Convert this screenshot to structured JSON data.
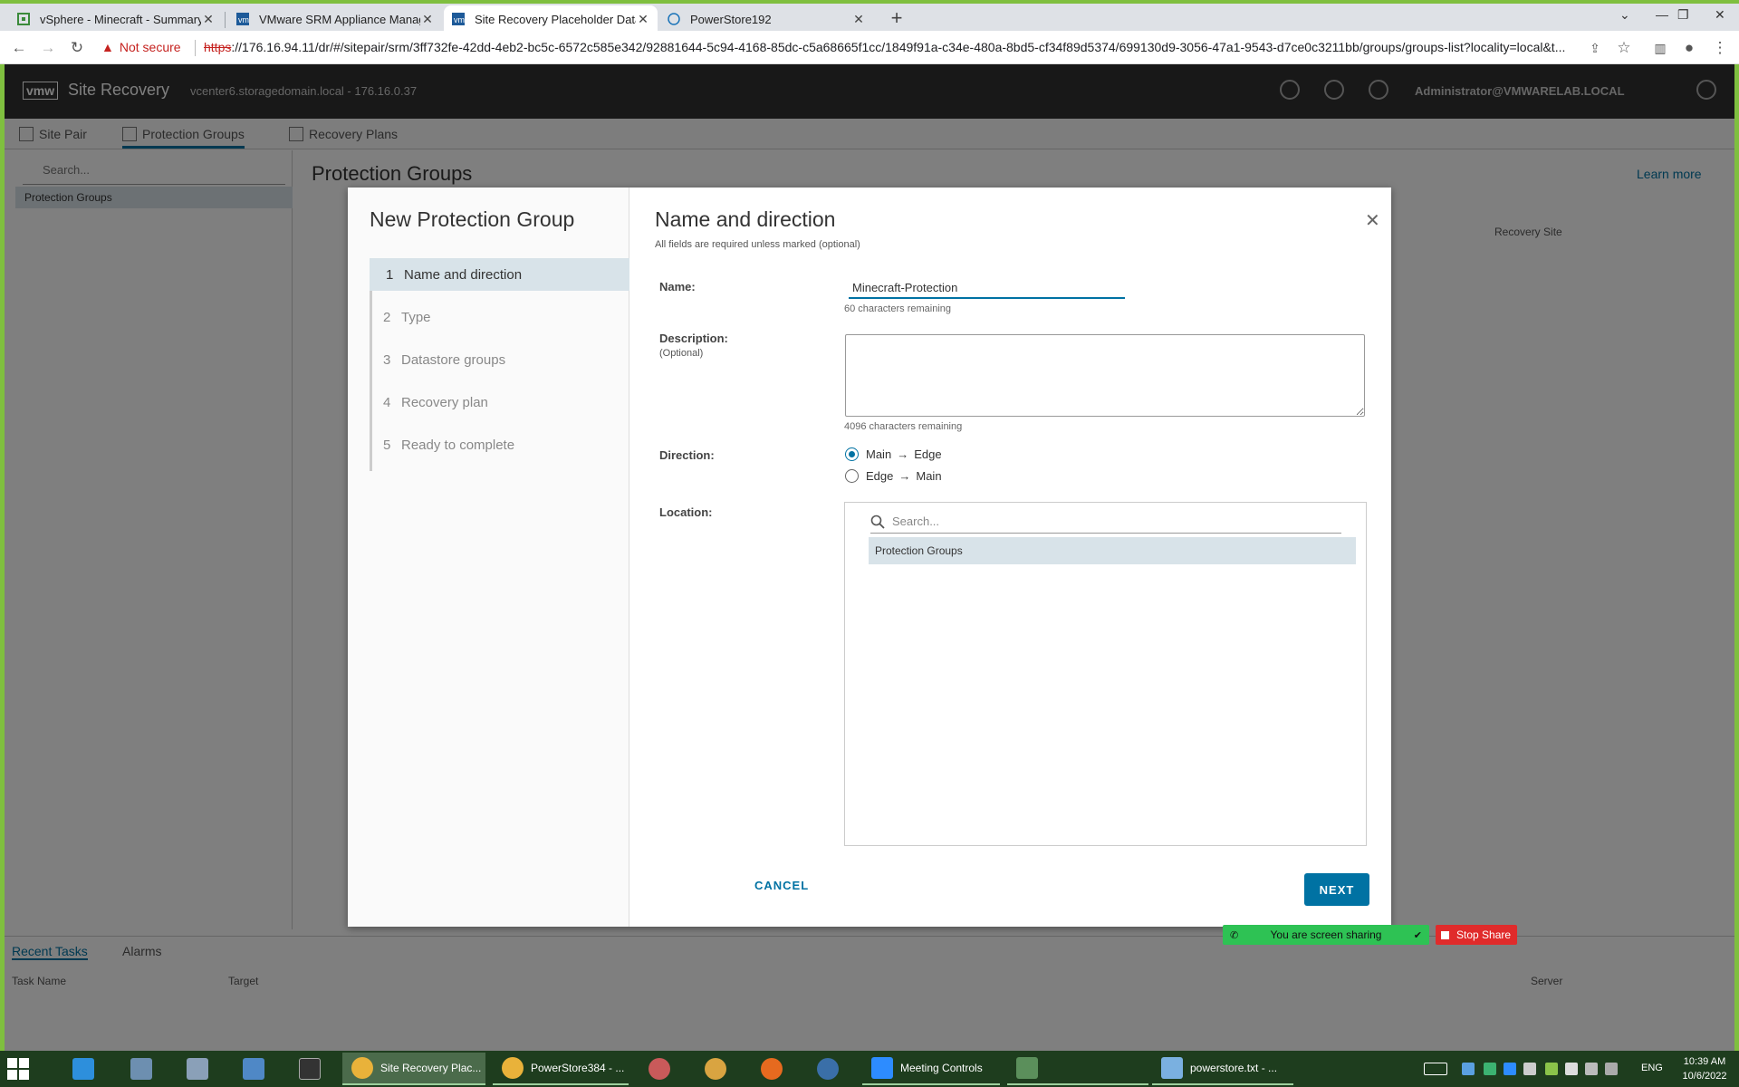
{
  "browser": {
    "tabs": [
      {
        "title": "vSphere - Minecraft - Summary",
        "icon": "vsphere-icon",
        "active": false
      },
      {
        "title": "VMware SRM Appliance Manage",
        "icon": "vmware-icon",
        "active": false
      },
      {
        "title": "Site Recovery Placeholder Datast",
        "icon": "vmware-icon",
        "active": true
      },
      {
        "title": "PowerStore192",
        "icon": "dell-icon",
        "active": false
      }
    ],
    "not_secure": "Not secure",
    "url_scheme": "https",
    "url_rest": "://176.16.94.11/dr/#/sitepair/srm/3ff732fe-42dd-4eb2-bc5c-6572c585e342/92881644-5c94-4168-85dc-c5a68665f1cc/1849f91a-c34e-480a-8bd5-cf34f89d5374/699130d9-3056-47a1-9543-d7ce0c3211bb/groups/groups-list?locality=local&t..."
  },
  "app": {
    "brand": "vmw",
    "name": "Site Recovery",
    "vcenter": "vcenter6.storagedomain.local - 176.16.0.37",
    "user": "Administrator@VMWARELAB.LOCAL",
    "nav": [
      "Site Pair",
      "Protection Groups",
      "Recovery Plans"
    ],
    "search_placeholder": "Search...",
    "tree_item": "Protection Groups",
    "page_title": "Protection Groups",
    "learn_more": "Learn more",
    "recovery_site_col": "Recovery Site",
    "recent_tabs": [
      "Recent Tasks",
      "Alarms"
    ],
    "recent_cols": [
      "Task Name",
      "Target",
      "Server"
    ]
  },
  "wizard": {
    "title": "New Protection Group",
    "steps": [
      {
        "num": "1",
        "label": "Name and direction",
        "active": true
      },
      {
        "num": "2",
        "label": "Type",
        "active": false
      },
      {
        "num": "3",
        "label": "Datastore groups",
        "active": false
      },
      {
        "num": "4",
        "label": "Recovery plan",
        "active": false
      },
      {
        "num": "5",
        "label": "Ready to complete",
        "active": false
      }
    ],
    "section_title": "Name and direction",
    "required_note": "All fields are required unless marked (optional)",
    "name_label": "Name:",
    "name_value": "Minecraft-Protection",
    "name_hint": "60 characters remaining",
    "description_label": "Description:",
    "description_optional": "(Optional)",
    "description_value": "",
    "description_hint": "4096 characters remaining",
    "direction_label": "Direction:",
    "directions": [
      {
        "from": "Main",
        "to": "Edge",
        "selected": true
      },
      {
        "from": "Edge",
        "to": "Main",
        "selected": false
      }
    ],
    "location_label": "Location:",
    "location_search_placeholder": "Search...",
    "location_item": "Protection Groups",
    "cancel_label": "CANCEL",
    "next_label": "NEXT"
  },
  "screen_share": {
    "status": "You are screen sharing",
    "stop_label": "Stop Share"
  },
  "taskbar": {
    "apps": [
      {
        "label": "Site Recovery Plac...",
        "active": true
      },
      {
        "label": "PowerStore384 - ...",
        "active": false
      },
      {
        "label": "Meeting Controls",
        "active": false
      },
      {
        "label": "powerstore.txt - ...",
        "active": false
      }
    ],
    "language": "ENG",
    "time": "10:39 AM",
    "date": "10/6/2022"
  }
}
